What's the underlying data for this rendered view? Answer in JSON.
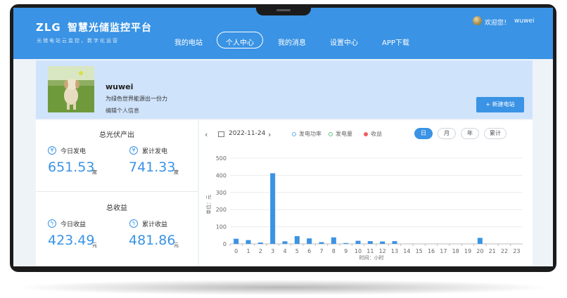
{
  "header": {
    "logo_mark": "ZLG",
    "logo_title": "智慧光储监控平台",
    "logo_subtitle": "光储电站云监控，数字化运营",
    "nav": [
      "我的电站",
      "个人中心",
      "我的消息",
      "设置中心",
      "APP下载"
    ],
    "active_nav": "个人中心",
    "welcome": "欢迎您！",
    "username": "wuwei"
  },
  "profile": {
    "name": "wuwei",
    "motto": "为绿色世界能源出一份力",
    "edit_link": "编辑个人信息",
    "new_station_button": "+ 新建电站"
  },
  "pv_output": {
    "title": "总光伏产出",
    "today_label": "今日发电",
    "today_value": "651.53",
    "today_unit": "度",
    "total_label": "累计发电",
    "total_value": "741.33",
    "total_unit": "度",
    "icon": "yen-icon"
  },
  "revenue": {
    "title": "总收益",
    "today_label": "今日收益",
    "today_value": "423.49",
    "today_unit": "元",
    "total_label": "累计收益",
    "total_value": "481.86",
    "total_unit": "元",
    "icon": "lightning-icon"
  },
  "chart_panel": {
    "date": "2022-11-24",
    "legend": [
      {
        "label": "发电功率",
        "color": "#5ab0e8"
      },
      {
        "label": "发电量",
        "color": "#58c47a"
      },
      {
        "label": "收益",
        "color": "#ee5f5f"
      }
    ],
    "ranges": [
      "日",
      "月",
      "年",
      "累计"
    ],
    "active_range": "日"
  },
  "chart_data": {
    "type": "bar",
    "categories": [
      "0",
      "1",
      "2",
      "3",
      "4",
      "5",
      "6",
      "7",
      "8",
      "9",
      "10",
      "11",
      "12",
      "13",
      "14",
      "15",
      "16",
      "17",
      "18",
      "19",
      "20",
      "21",
      "22",
      "23"
    ],
    "values": [
      30,
      22,
      8,
      412,
      15,
      45,
      32,
      10,
      38,
      5,
      18,
      16,
      14,
      16,
      0,
      0,
      0,
      0,
      0,
      0,
      35,
      0,
      0,
      0
    ],
    "xlabel": "时间：小时",
    "ylabel": "单位：元",
    "ylim": [
      0,
      500
    ],
    "yticks": [
      0,
      100,
      200,
      300,
      400,
      500
    ],
    "bar_color": "#3a93e4",
    "grid": true
  }
}
